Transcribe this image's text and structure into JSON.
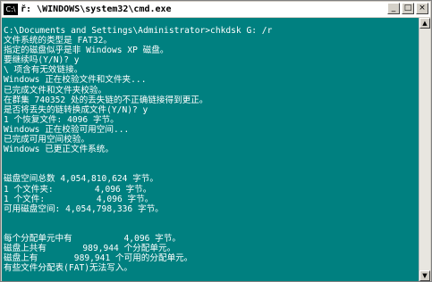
{
  "window": {
    "title": "ř: \\WINDOWS\\system32\\cmd.exe",
    "icon_label": "C:\\",
    "controls": [
      "_",
      "□",
      "×"
    ]
  },
  "console": {
    "lines": [
      "C:\\Documents and Settings\\Administrator>chkdsk G: /r",
      "文件系统的类型是 FAT32。",
      "指定的磁盘似乎是非 Windows XP 磁盘。",
      "要继续吗(Y/N)? y",
      "\\ 项含有无效链接。",
      "Windows 正在校验文件和文件夹...",
      "已完成文件和文件夹校验。",
      "在群集 740352 处的丢失链的不正确链接得到更正。",
      "是否将丢失的链转换成文件(Y/N)? y",
      "1 个恢复文件: 4096 字节。",
      "Windows 正在校验可用空间...",
      "已完成可用空间校验。",
      "Windows 已更正文件系统。",
      "",
      "",
      "磁盘空间总数 4,054,810,624 字节。",
      "1 个文件夹:        4,096 字节。",
      "1 个文件:          4,096 字节。",
      "可用磁盘空间: 4,054,798,336 字节。",
      "",
      "",
      "每个分配单元中有          4,096 字节。",
      "磁盘上共有       989,944 个分配单元。",
      "磁盘上有       989,941 个可用的分配单元。",
      "有些文件分配表(FAT)无法写入。"
    ]
  },
  "scrollbar": {
    "up": "▲",
    "down": "▼"
  }
}
